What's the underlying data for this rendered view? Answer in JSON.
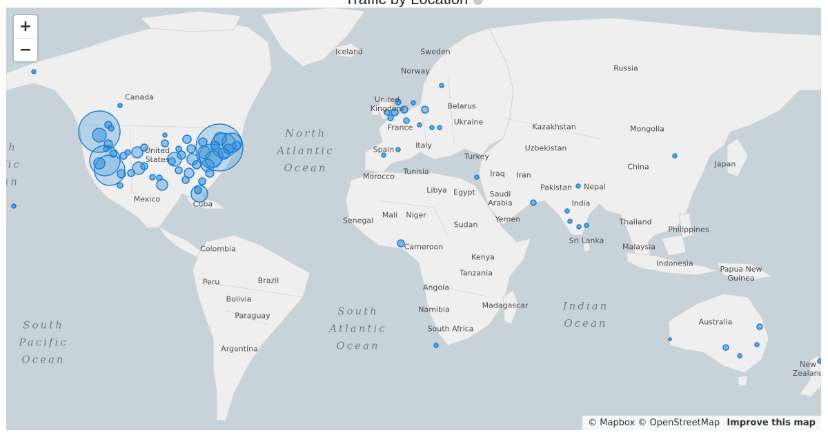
{
  "title": "Traffic by Location",
  "icons": {
    "info": "info-circle-icon",
    "zoom_in": "plus-icon",
    "zoom_out": "minus-icon"
  },
  "controls": {
    "zoom_in": "+",
    "zoom_out": "−"
  },
  "attribution": {
    "mapbox": "© Mapbox",
    "osm": "© OpenStreetMap",
    "improve": "Improve this map"
  },
  "colors": {
    "water": "#c8d3d9",
    "land": "#efefef",
    "marker_fill": "#2f8fdc",
    "marker_stroke": "#1f7fd0"
  },
  "labels": {
    "iceland": "Iceland",
    "sweden": "Sweden",
    "norway": "Norway",
    "russia": "Russia",
    "canada": "Canada",
    "uk": "United\nKingdom",
    "belarus": "Belarus",
    "france": "France",
    "ukraine": "Ukraine",
    "kazakhstan": "Kazakhstan",
    "mongolia": "Mongolia",
    "spain": "Spain",
    "italy": "Italy",
    "uzbekistan": "Uzbekistan",
    "us": "United\nStates",
    "turkey": "Turkey",
    "china": "China",
    "japan": "Japan",
    "tunisia": "Tunisia",
    "morocco": "Morocco",
    "iraq": "Iraq",
    "iran": "Iran",
    "pakistan": "Pakistan",
    "nepal": "Nepal",
    "mexico": "Mexico",
    "cuba": "Cuba",
    "libya": "Libya",
    "egypt": "Egypt",
    "saudi_arabia": "Saudi\nArabia",
    "india": "India",
    "mali": "Mali",
    "niger": "Niger",
    "senegal": "Senegal",
    "sudan": "Sudan",
    "yemen": "Yemen",
    "thailand": "Thailand",
    "philippines": "Philippines",
    "sri_lanka": "Sri Lanka",
    "colombia": "Colombia",
    "cameroon": "Cameroon",
    "malaysia": "Malaysia",
    "kenya": "Kenya",
    "indonesia": "Indonesia",
    "papua_new_guinea": "Papua New\nGuinea",
    "peru": "Peru",
    "brazil": "Brazil",
    "tanzania": "Tanzania",
    "angola": "Angola",
    "bolivia": "Bolivia",
    "madagascar": "Madagascar",
    "namibia": "Namibia",
    "paraguay": "Paraguay",
    "australia": "Australia",
    "south_africa": "South Africa",
    "argentina": "Argentina",
    "new_zealand": "New\nZealand",
    "north_atlantic": "North\nAtlantic\nOcean",
    "south_atlantic": "South\nAtlantic\nOcean",
    "indian_ocean": "Indian\nOcean",
    "south_pacific": "South\nPacific\nOcean",
    "north_pacific_partial": "th\nfic\nan"
  }
}
